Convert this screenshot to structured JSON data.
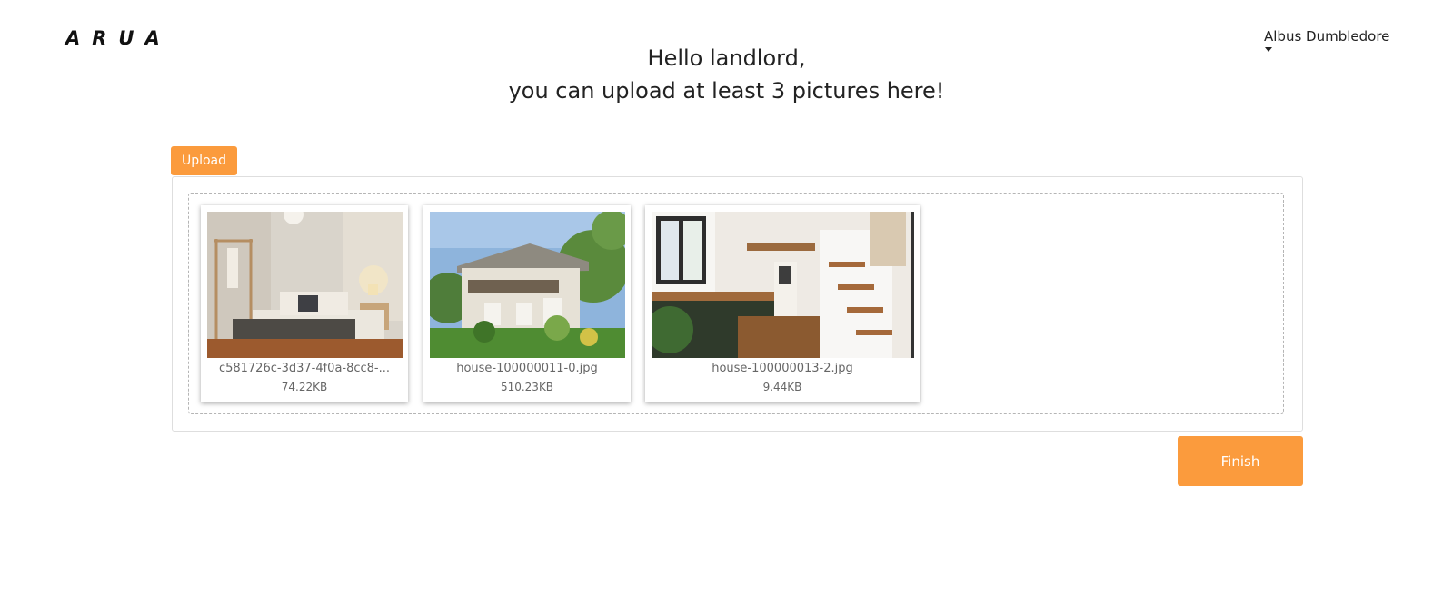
{
  "header": {
    "logo": "ARUA",
    "user_name": "Albus Dumbledore"
  },
  "main": {
    "greeting_line1": "Hello landlord,",
    "greeting_line2": "you can upload at least 3 pictures here!",
    "upload_label": "Upload",
    "finish_label": "Finish"
  },
  "files": [
    {
      "name": "c581726c-3d37-4f0a-8cc8-...",
      "size": "74.22KB"
    },
    {
      "name": "house-100000011-0.jpg",
      "size": "510.23KB"
    },
    {
      "name": "house-100000013-2.jpg",
      "size": "9.44KB"
    }
  ],
  "colors": {
    "accent": "#fb9b3d"
  }
}
